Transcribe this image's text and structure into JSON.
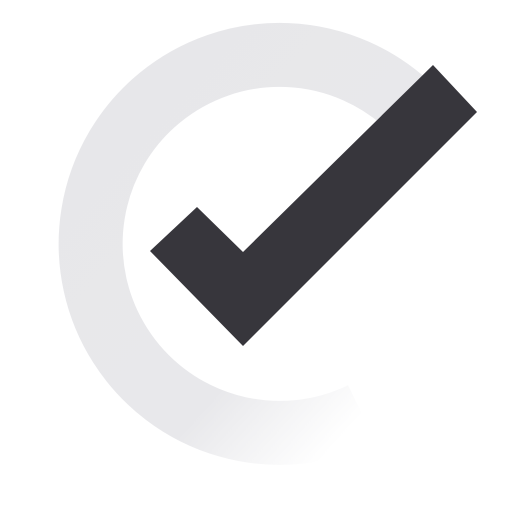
{
  "icon": {
    "name": "checkmark-icon",
    "ring_color": "#e7e7ea",
    "check_color": "#37363c",
    "background_color": "#ffffff"
  }
}
